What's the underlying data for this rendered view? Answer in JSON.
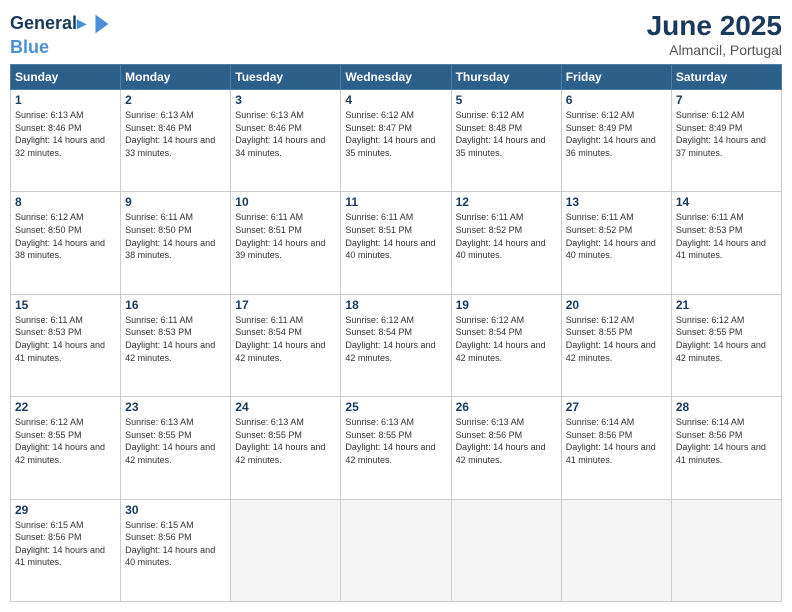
{
  "header": {
    "logo_line1": "General",
    "logo_line2": "Blue",
    "month_title": "June 2025",
    "location": "Almancil, Portugal"
  },
  "days_of_week": [
    "Sunday",
    "Monday",
    "Tuesday",
    "Wednesday",
    "Thursday",
    "Friday",
    "Saturday"
  ],
  "weeks": [
    [
      {
        "day": "1",
        "sunrise": "6:13 AM",
        "sunset": "8:46 PM",
        "daylight": "14 hours and 32 minutes."
      },
      {
        "day": "2",
        "sunrise": "6:13 AM",
        "sunset": "8:46 PM",
        "daylight": "14 hours and 33 minutes."
      },
      {
        "day": "3",
        "sunrise": "6:13 AM",
        "sunset": "8:46 PM",
        "daylight": "14 hours and 34 minutes."
      },
      {
        "day": "4",
        "sunrise": "6:12 AM",
        "sunset": "8:47 PM",
        "daylight": "14 hours and 35 minutes."
      },
      {
        "day": "5",
        "sunrise": "6:12 AM",
        "sunset": "8:48 PM",
        "daylight": "14 hours and 35 minutes."
      },
      {
        "day": "6",
        "sunrise": "6:12 AM",
        "sunset": "8:49 PM",
        "daylight": "14 hours and 36 minutes."
      },
      {
        "day": "7",
        "sunrise": "6:12 AM",
        "sunset": "8:49 PM",
        "daylight": "14 hours and 37 minutes."
      }
    ],
    [
      {
        "day": "8",
        "sunrise": "6:12 AM",
        "sunset": "8:50 PM",
        "daylight": "14 hours and 38 minutes."
      },
      {
        "day": "9",
        "sunrise": "6:11 AM",
        "sunset": "8:50 PM",
        "daylight": "14 hours and 38 minutes."
      },
      {
        "day": "10",
        "sunrise": "6:11 AM",
        "sunset": "8:51 PM",
        "daylight": "14 hours and 39 minutes."
      },
      {
        "day": "11",
        "sunrise": "6:11 AM",
        "sunset": "8:51 PM",
        "daylight": "14 hours and 40 minutes."
      },
      {
        "day": "12",
        "sunrise": "6:11 AM",
        "sunset": "8:52 PM",
        "daylight": "14 hours and 40 minutes."
      },
      {
        "day": "13",
        "sunrise": "6:11 AM",
        "sunset": "8:52 PM",
        "daylight": "14 hours and 40 minutes."
      },
      {
        "day": "14",
        "sunrise": "6:11 AM",
        "sunset": "8:53 PM",
        "daylight": "14 hours and 41 minutes."
      }
    ],
    [
      {
        "day": "15",
        "sunrise": "6:11 AM",
        "sunset": "8:53 PM",
        "daylight": "14 hours and 41 minutes."
      },
      {
        "day": "16",
        "sunrise": "6:11 AM",
        "sunset": "8:53 PM",
        "daylight": "14 hours and 42 minutes."
      },
      {
        "day": "17",
        "sunrise": "6:11 AM",
        "sunset": "8:54 PM",
        "daylight": "14 hours and 42 minutes."
      },
      {
        "day": "18",
        "sunrise": "6:12 AM",
        "sunset": "8:54 PM",
        "daylight": "14 hours and 42 minutes."
      },
      {
        "day": "19",
        "sunrise": "6:12 AM",
        "sunset": "8:54 PM",
        "daylight": "14 hours and 42 minutes."
      },
      {
        "day": "20",
        "sunrise": "6:12 AM",
        "sunset": "8:55 PM",
        "daylight": "14 hours and 42 minutes."
      },
      {
        "day": "21",
        "sunrise": "6:12 AM",
        "sunset": "8:55 PM",
        "daylight": "14 hours and 42 minutes."
      }
    ],
    [
      {
        "day": "22",
        "sunrise": "6:12 AM",
        "sunset": "8:55 PM",
        "daylight": "14 hours and 42 minutes."
      },
      {
        "day": "23",
        "sunrise": "6:13 AM",
        "sunset": "8:55 PM",
        "daylight": "14 hours and 42 minutes."
      },
      {
        "day": "24",
        "sunrise": "6:13 AM",
        "sunset": "8:55 PM",
        "daylight": "14 hours and 42 minutes."
      },
      {
        "day": "25",
        "sunrise": "6:13 AM",
        "sunset": "8:55 PM",
        "daylight": "14 hours and 42 minutes."
      },
      {
        "day": "26",
        "sunrise": "6:13 AM",
        "sunset": "8:56 PM",
        "daylight": "14 hours and 42 minutes."
      },
      {
        "day": "27",
        "sunrise": "6:14 AM",
        "sunset": "8:56 PM",
        "daylight": "14 hours and 41 minutes."
      },
      {
        "day": "28",
        "sunrise": "6:14 AM",
        "sunset": "8:56 PM",
        "daylight": "14 hours and 41 minutes."
      }
    ],
    [
      {
        "day": "29",
        "sunrise": "6:15 AM",
        "sunset": "8:56 PM",
        "daylight": "14 hours and 41 minutes."
      },
      {
        "day": "30",
        "sunrise": "6:15 AM",
        "sunset": "8:56 PM",
        "daylight": "14 hours and 40 minutes."
      },
      null,
      null,
      null,
      null,
      null
    ]
  ]
}
